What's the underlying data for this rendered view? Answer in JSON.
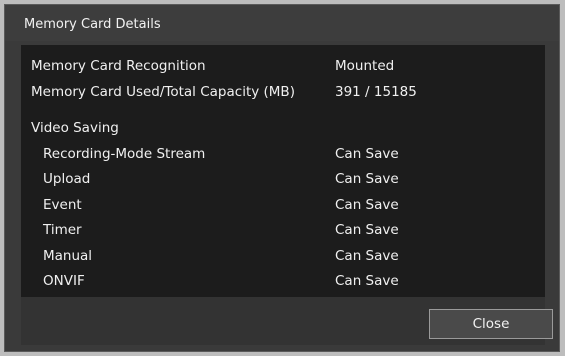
{
  "dialog": {
    "title": "Memory Card Details"
  },
  "details": {
    "recognition_label": "Memory Card Recognition",
    "recognition_value": "Mounted",
    "capacity_label": "Memory Card Used/Total Capacity (MB)",
    "capacity_value": "391 / 15185",
    "video_saving_label": "Video Saving"
  },
  "video_saving": [
    {
      "label": "Recording-Mode Stream",
      "value": "Can Save"
    },
    {
      "label": "Upload",
      "value": "Can Save"
    },
    {
      "label": "Event",
      "value": "Can Save"
    },
    {
      "label": "Timer",
      "value": "Can Save"
    },
    {
      "label": "Manual",
      "value": "Can Save"
    },
    {
      "label": "ONVIF",
      "value": "Can Save"
    }
  ],
  "footer": {
    "close_label": "Close"
  }
}
